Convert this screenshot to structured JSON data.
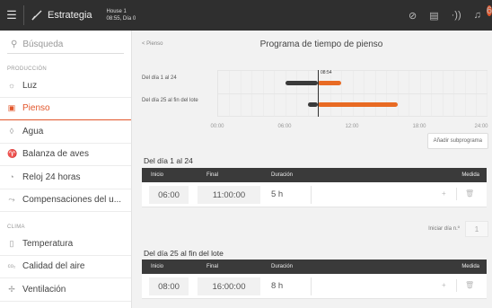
{
  "topbar": {
    "brand": "Estrategia",
    "house_name": "House 1",
    "house_time": "08:55, Día 0",
    "notification_count": "6"
  },
  "sidebar": {
    "search_placeholder": "Búsqueda",
    "section_production": "PRODUCCIÓN",
    "section_climate": "CLIMA",
    "items": [
      {
        "label": "Luz",
        "icon": "bulb-icon"
      },
      {
        "label": "Pienso",
        "icon": "feed-icon",
        "active": true
      },
      {
        "label": "Agua",
        "icon": "water-drop-icon"
      },
      {
        "label": "Balanza de aves",
        "icon": "bird-icon"
      },
      {
        "label": "Reloj 24 horas",
        "icon": "clock-icon"
      },
      {
        "label": "Compensaciones del u...",
        "icon": "compensation-icon"
      }
    ],
    "climate_items": [
      {
        "label": "Temperatura",
        "icon": "thermometer-icon"
      },
      {
        "label": "Calidad del aire",
        "icon": "co2-icon"
      },
      {
        "label": "Ventilación",
        "icon": "fan-icon"
      }
    ]
  },
  "main": {
    "back_label": "< Pienso",
    "title": "Programa de tiempo de pienso",
    "timeline": {
      "rows": [
        "Del día 1 al 24",
        "Del día 25 al fin del lote"
      ],
      "now_label": "08:54",
      "ticks": [
        "00:00",
        "06:00",
        "12:00",
        "18:00",
        "24:00"
      ]
    },
    "add_button": "Añadir subprograma",
    "start_day_label": "Iniciar día n.º",
    "start_day_value": "1",
    "columns": {
      "start": "Inicio",
      "end": "Final",
      "duration": "Duración",
      "action": "Medida"
    },
    "programs": [
      {
        "title": "Del día 1 al 24",
        "start": "06:00",
        "end": "11:00:00",
        "duration": "5 h"
      },
      {
        "title": "Del día 25 al fin del lote",
        "start": "08:00",
        "end": "16:00:00",
        "duration": "8 h"
      }
    ]
  },
  "colors": {
    "accent": "#e2562b",
    "bar_orange": "#e86a23",
    "bar_dark": "#3a3a3a",
    "topbar": "#2f2f2f"
  }
}
